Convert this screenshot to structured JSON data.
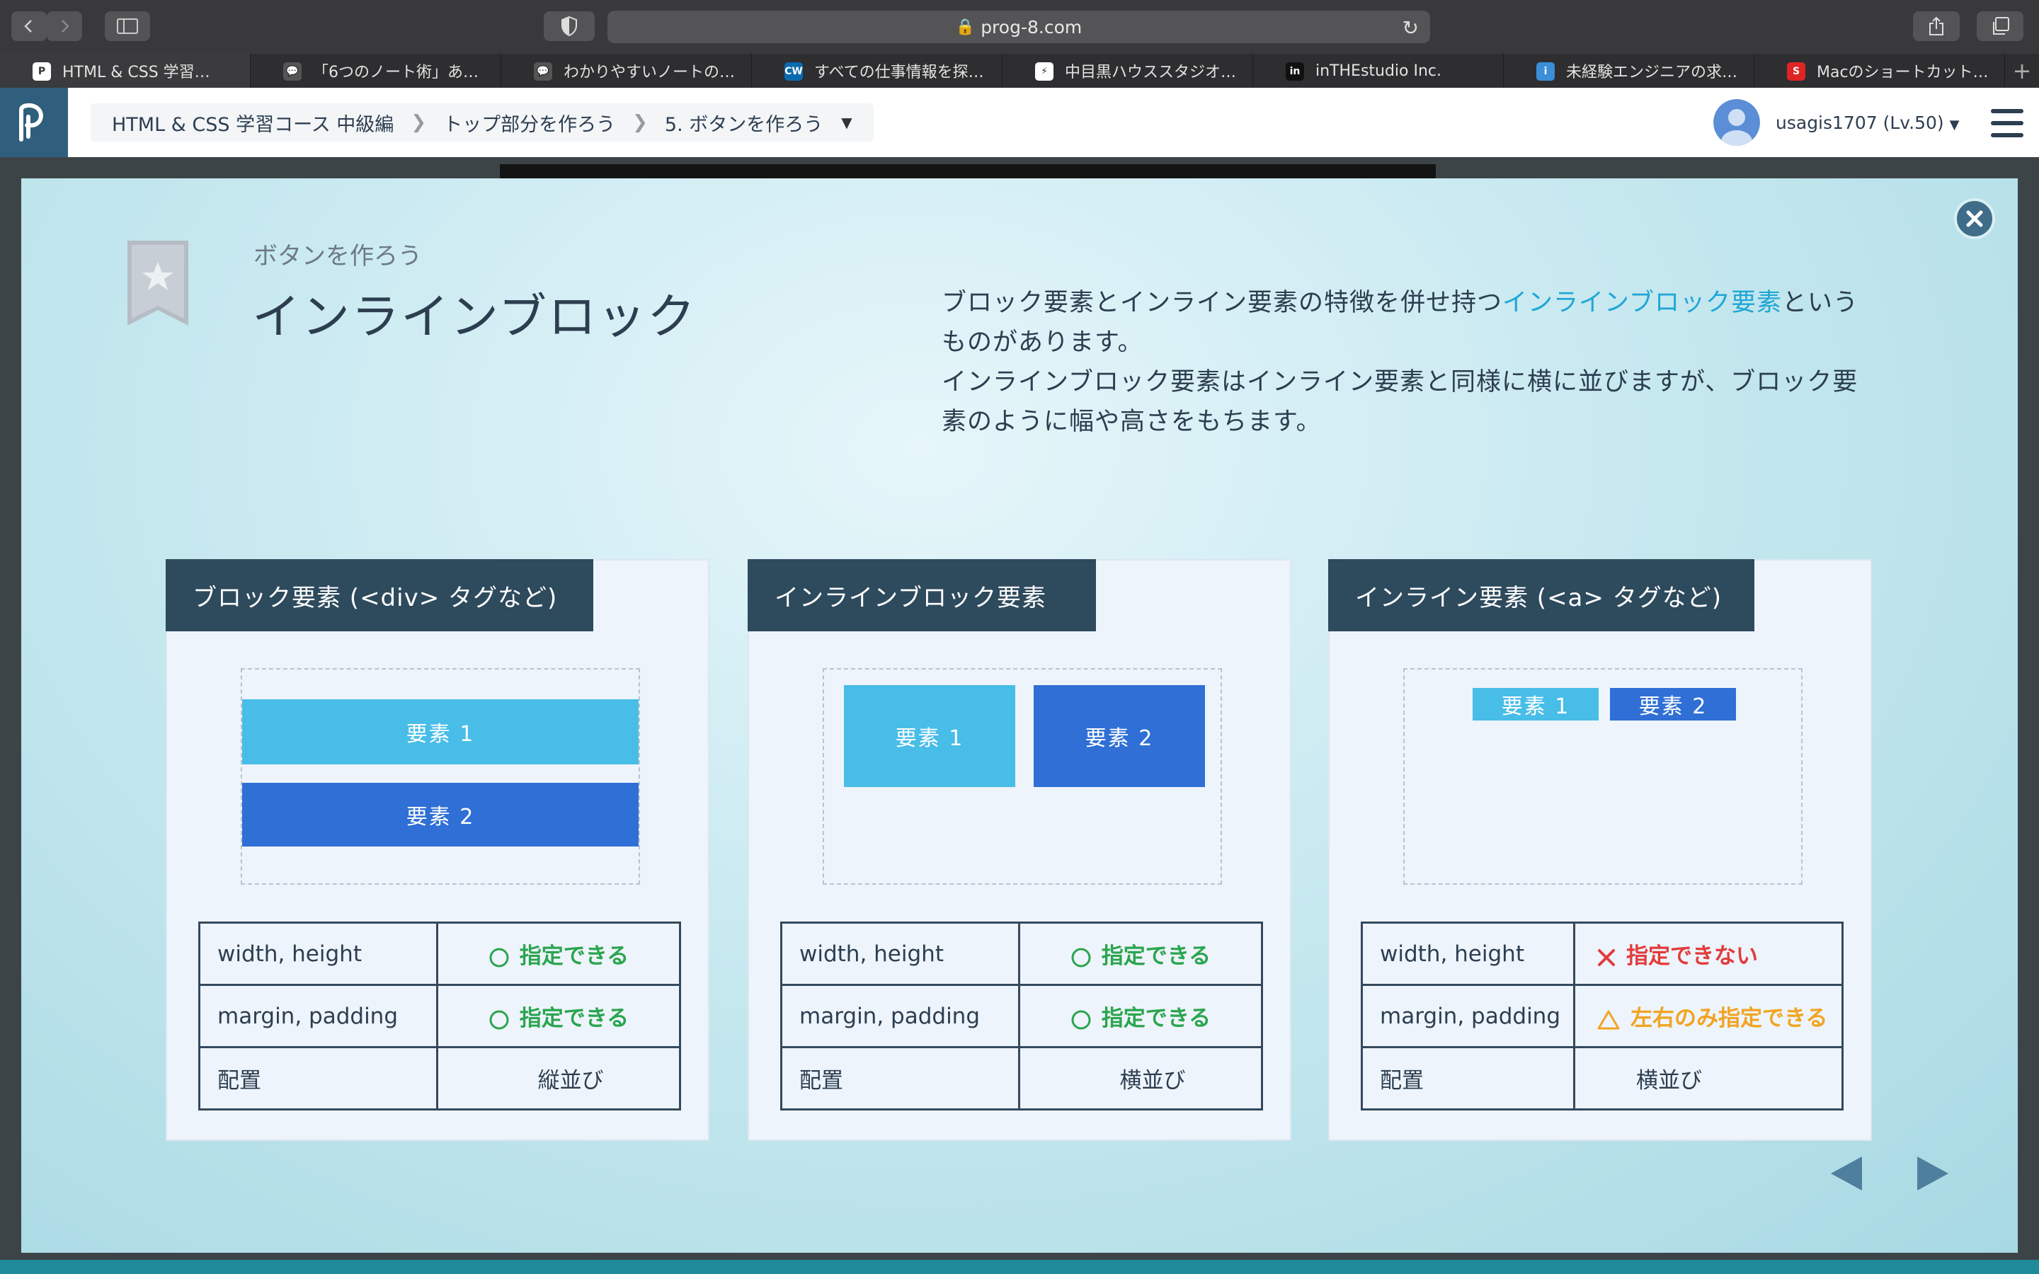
{
  "browser": {
    "url": "prog-8.com",
    "tabs": [
      {
        "label": "HTML & CSS 学習…",
        "fav_bg": "#ffffff",
        "fav_fg": "#333333",
        "fav_text": "P",
        "active": true
      },
      {
        "label": "「6つのノート術」あ…",
        "fav_bg": "#555555",
        "fav_fg": "#ffffff",
        "fav_text": "💬",
        "active": false
      },
      {
        "label": "わかりやすいノートの…",
        "fav_bg": "#555555",
        "fav_fg": "#ffffff",
        "fav_text": "💬",
        "active": false
      },
      {
        "label": "すべての仕事情報を探…",
        "fav_bg": "#0b6ab0",
        "fav_fg": "#ffffff",
        "fav_text": "CW",
        "active": false
      },
      {
        "label": "中目黒ハウススタジオ…",
        "fav_bg": "#ffffff",
        "fav_fg": "#333333",
        "fav_text": "⚡",
        "active": false
      },
      {
        "label": "inTHEstudio Inc.",
        "fav_bg": "#111111",
        "fav_fg": "#ffffff",
        "fav_text": "in",
        "active": false
      },
      {
        "label": "未経験エンジニアの求…",
        "fav_bg": "#3a8fd8",
        "fav_fg": "#ffffff",
        "fav_text": "i",
        "active": false
      },
      {
        "label": "Macのショートカット…",
        "fav_bg": "#e02424",
        "fav_fg": "#ffffff",
        "fav_text": "S",
        "active": false
      }
    ]
  },
  "header": {
    "breadcrumb": [
      "HTML & CSS 学習コース 中級編",
      "トップ部分を作ろう",
      "5. ボタンを作ろう"
    ],
    "username": "usagis1707 (Lv.50)"
  },
  "slide": {
    "subtitle": "ボタンを作ろう",
    "title": "インラインブロック",
    "description": {
      "p1_pre": "ブロック要素とインライン要素の特徴を併せ持つ",
      "p1_highlight": "インラインブロック要素",
      "p1_post": "というものがあります。",
      "p2": "インラインブロック要素はインライン要素と同様に横に並びますが、ブロック要素のように幅や高さをもちます。"
    },
    "cards": [
      {
        "heading": "ブロック要素 (<div> タグなど)",
        "elem1": "要素 1",
        "elem2": "要素 2",
        "rows": [
          {
            "key": "width, height",
            "value": "指定できる"
          },
          {
            "key": "margin, padding",
            "value": "指定できる"
          },
          {
            "key": "配置",
            "value": "縦並び"
          }
        ]
      },
      {
        "heading": "インラインブロック要素",
        "elem1": "要素 1",
        "elem2": "要素 2",
        "rows": [
          {
            "key": "width, height",
            "value": "指定できる"
          },
          {
            "key": "margin, padding",
            "value": "指定できる"
          },
          {
            "key": "配置",
            "value": "横並び"
          }
        ]
      },
      {
        "heading": "インライン要素 (<a> タグなど)",
        "elem1": "要素 1",
        "elem2": "要素 2",
        "rows": [
          {
            "key": "width, height",
            "value": "指定できない"
          },
          {
            "key": "margin, padding",
            "value": "左右のみ指定できる"
          },
          {
            "key": "配置",
            "value": "横並び"
          }
        ]
      }
    ]
  },
  "colors": {
    "ok": "#2ba54f",
    "ng": "#e23c3c",
    "warn": "#f1a422",
    "highlight": "#1fa6d6",
    "card_header": "#2e4a5d",
    "element_light": "#48bde8",
    "element_dark": "#2f6fd6"
  }
}
